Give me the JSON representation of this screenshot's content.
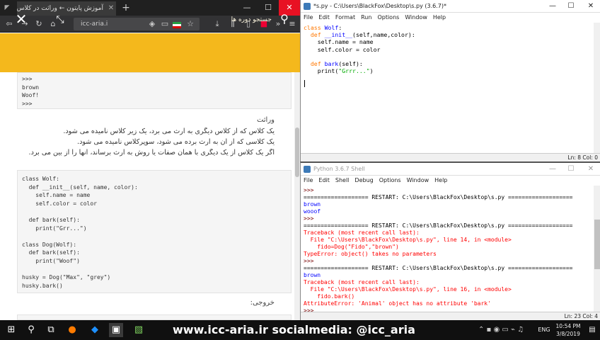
{
  "browser": {
    "tab_title": "آموزش پایتون ← وراثت در کلاس ...",
    "url": "icc-aria.i",
    "search_placeholder": "جستجو دوره ها",
    "output_top": ">>>\nbrown\nWoof!\n>>>",
    "section_title": "وراثت",
    "paragraphs": [
      "یک کلاس که از کلاس دیگری به ارث می برد، یک زیر کلاس نامیده می شود.",
      "یک کلاسی که از آن به ارث برده می شود، سوپرکلاس نامیده می شود.",
      "اگر یک کلاس از یک دیگری با همان صفات یا روش به ارث برساند، آنها را از بین می برد."
    ],
    "code_example": "class Wolf:\n  def __init__(self, name, color):\n    self.name = name\n    self.color = color\n\n  def bark(self):\n    print(\"Grr...\")\n\nclass Dog(Wolf):\n  def bark(self):\n    print(\"Woof\")\n\nhusky = Dog(\"Max\", \"grey\")\nhusky.bark()",
    "output_label": "خروجی:"
  },
  "editor": {
    "title": "*s.py - C:\\Users\\BlackFox\\Desktop\\s.py (3.6.7)*",
    "menu": [
      "File",
      "Edit",
      "Format",
      "Run",
      "Options",
      "Window",
      "Help"
    ],
    "status": "Ln: 8   Col: 0",
    "code": {
      "l1_kw": "class",
      "l1_name": " Wolf",
      "l1_rest": ":",
      "l2_indent": "  ",
      "l2_kw": "def",
      "l2_name": " __init__",
      "l2_rest": "(self,name,color):",
      "l3": "    self.name = name",
      "l4": "    self.color = color",
      "l6_indent": "  ",
      "l6_kw": "def",
      "l6_name": " bark",
      "l6_rest": "(self):",
      "l7_pre": "    print(",
      "l7_str": "\"Grrr...\"",
      "l7_post": ")"
    }
  },
  "shell": {
    "title": "Python 3.6.7 Shell",
    "menu": [
      "File",
      "Edit",
      "Shell",
      "Debug",
      "Options",
      "Window",
      "Help"
    ],
    "status": "Ln: 23   Col: 4",
    "lines": [
      {
        "cls": "pr",
        "text": ">>>"
      },
      {
        "cls": "rs",
        "text": "=================== RESTART: C:\\Users\\BlackFox\\Desktop\\s.py ==================="
      },
      {
        "cls": "ou",
        "text": "brown"
      },
      {
        "cls": "ou",
        "text": "wooof"
      },
      {
        "cls": "pr",
        "text": ">>>"
      },
      {
        "cls": "rs",
        "text": "=================== RESTART: C:\\Users\\BlackFox\\Desktop\\s.py ==================="
      },
      {
        "cls": "er",
        "text": "Traceback (most recent call last):"
      },
      {
        "cls": "er",
        "text": "  File \"C:\\Users\\BlackFox\\Desktop\\s.py\", line 14, in <module>"
      },
      {
        "cls": "er",
        "text": "    fido=Dog(\"Fido\",\"brown\")"
      },
      {
        "cls": "er",
        "text": "TypeError: object() takes no parameters"
      },
      {
        "cls": "pr",
        "text": ">>>"
      },
      {
        "cls": "rs",
        "text": "=================== RESTART: C:\\Users\\BlackFox\\Desktop\\s.py ==================="
      },
      {
        "cls": "ou",
        "text": "brown"
      },
      {
        "cls": "er",
        "text": "Traceback (most recent call last):"
      },
      {
        "cls": "er",
        "text": "  File \"C:\\Users\\BlackFox\\Desktop\\s.py\", line 16, in <module>"
      },
      {
        "cls": "er",
        "text": "    fido.bark()"
      },
      {
        "cls": "er",
        "text": "AttributeError: 'Animal' object has no attribute 'bark'"
      },
      {
        "cls": "pr",
        "text": ">>>"
      }
    ]
  },
  "taskbar": {
    "watermark": "www.icc-aria.ir   socialmedia: @icc_aria",
    "lang": "ENG",
    "time": "10:54 PM",
    "date": "3/8/2019"
  },
  "colors": {
    "site_header": "#f4b81c",
    "idle_keyword": "#ff7700",
    "idle_def_name": "#0000ff",
    "idle_string": "#00aa00",
    "shell_error": "#ff0000",
    "shell_output": "#0000ff"
  }
}
